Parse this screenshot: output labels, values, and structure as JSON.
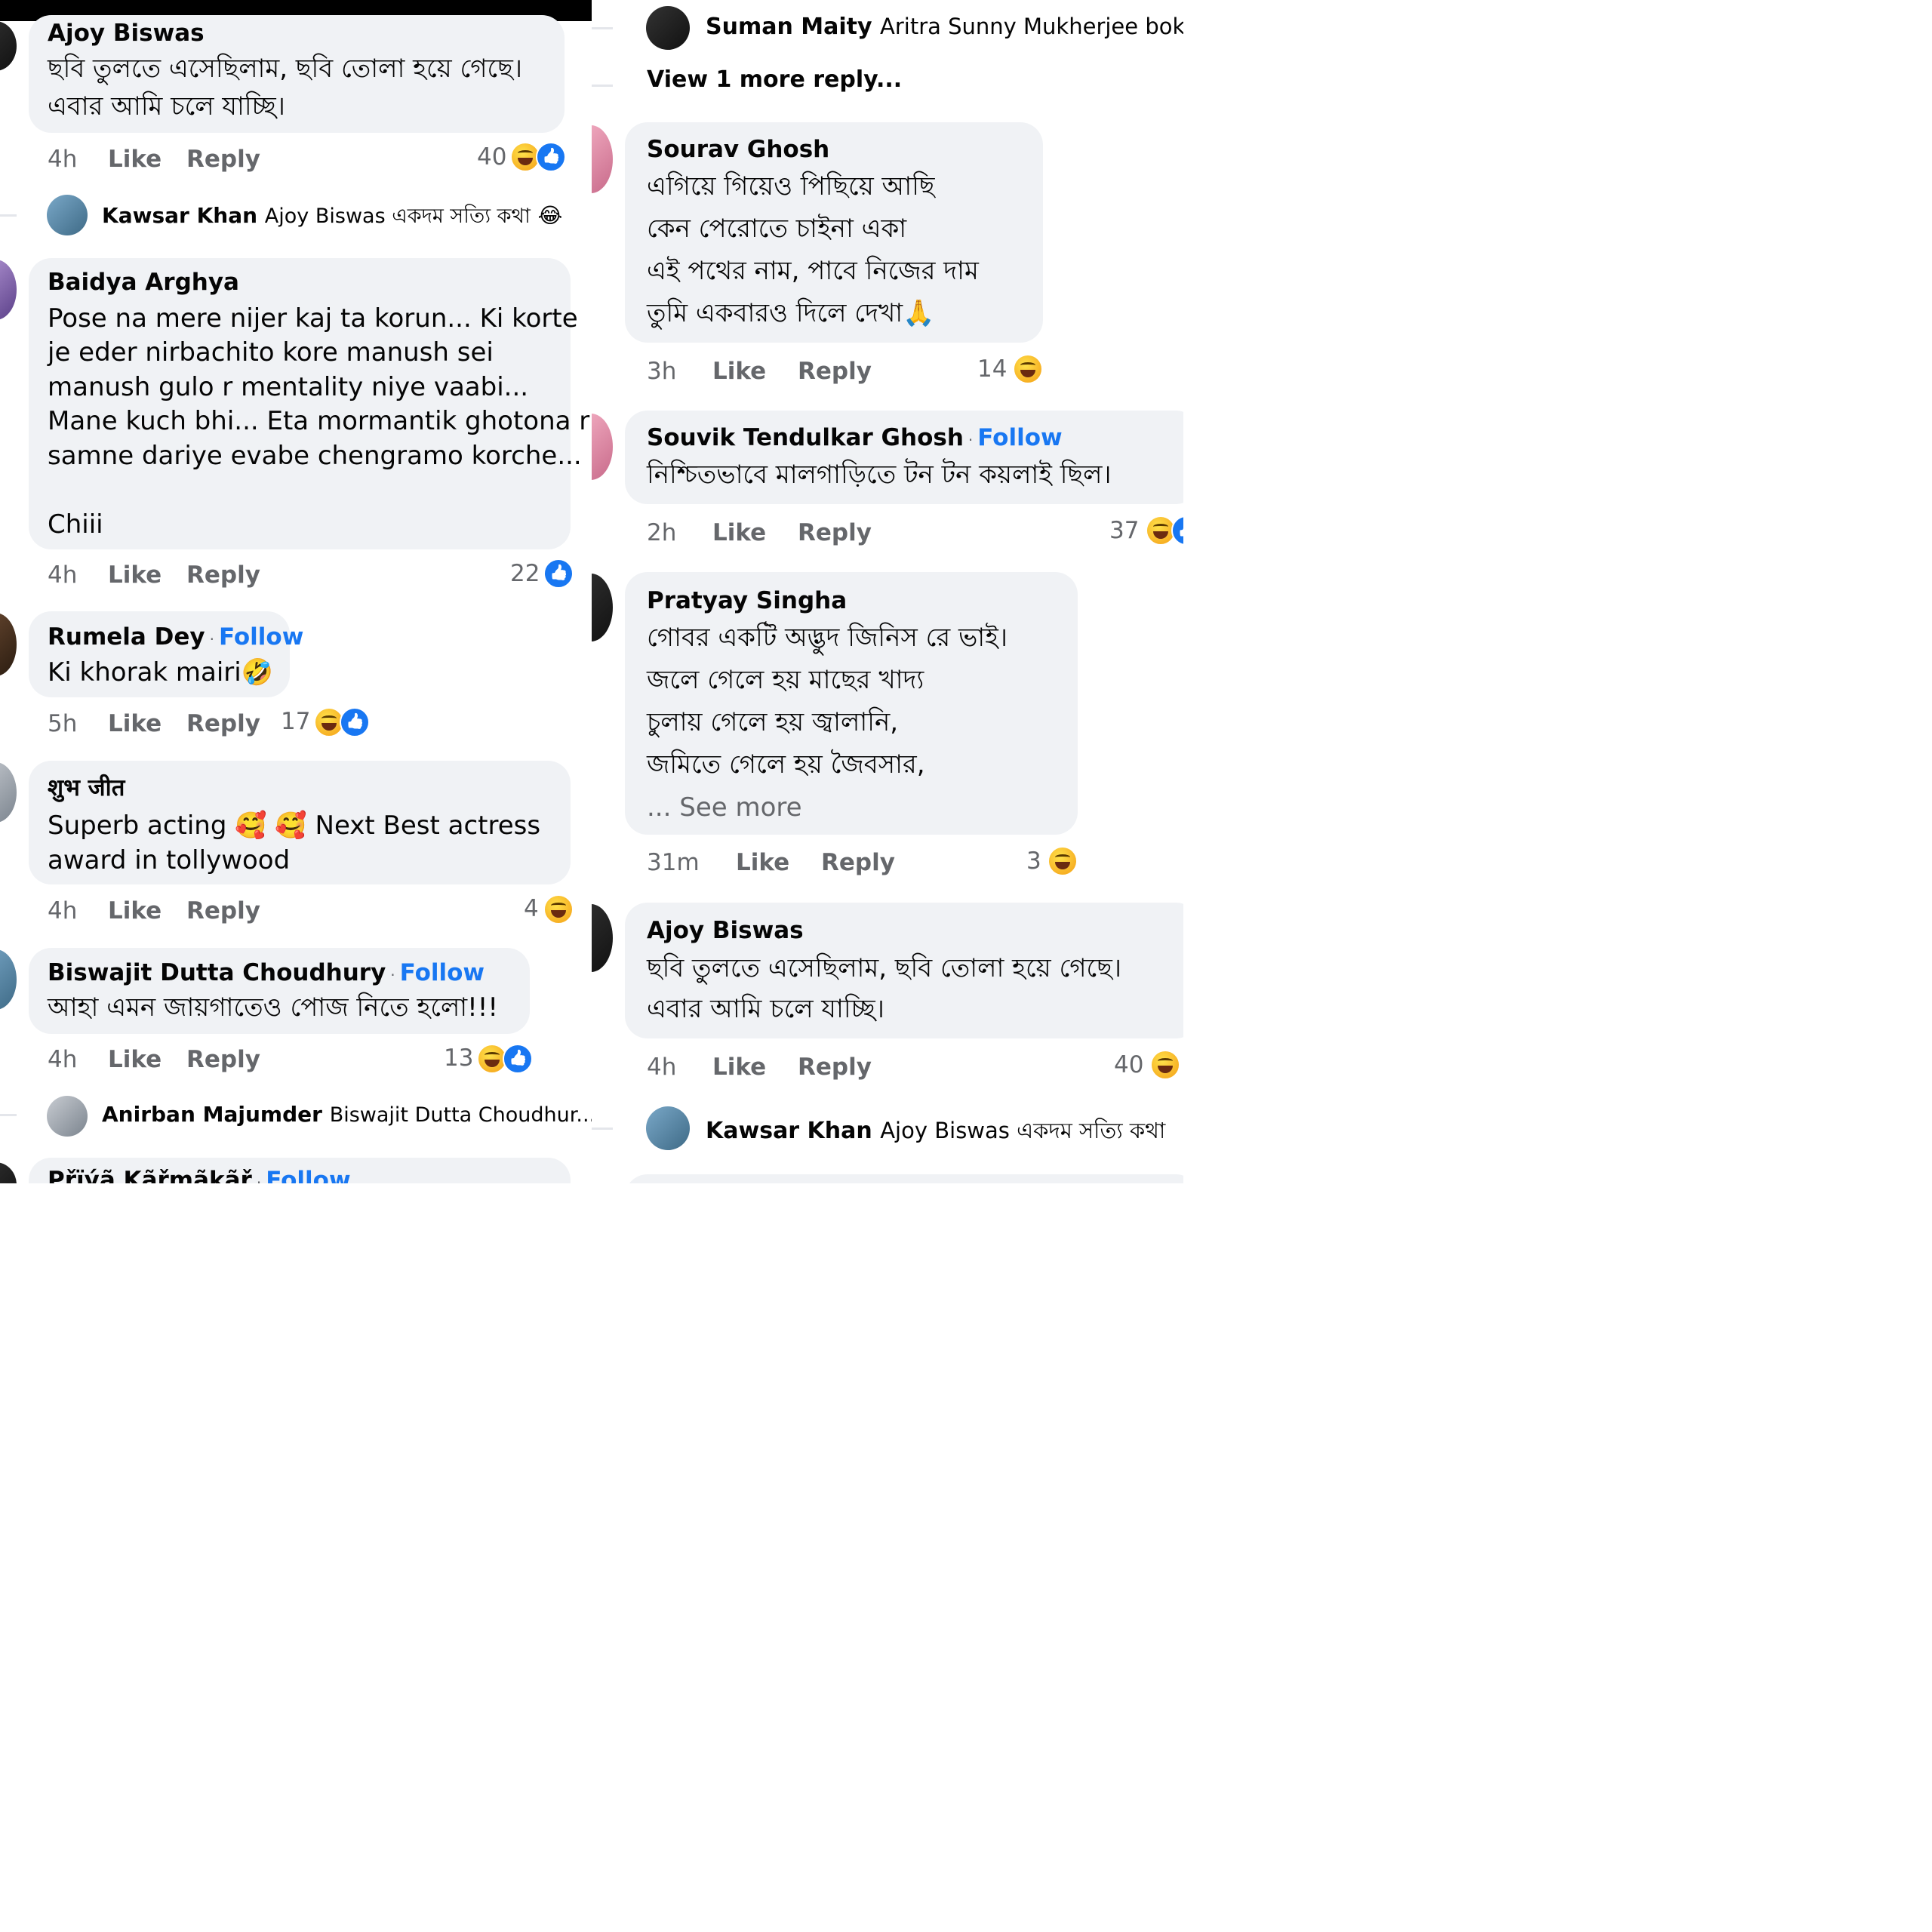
{
  "labels": {
    "like": "Like",
    "reply": "Reply",
    "follow": "Follow",
    "dot": "·"
  },
  "left": {
    "c1": {
      "name": "Ajoy Biswas",
      "lines": [
        "ছবি তুলতে এসেছিলাম,  ছবি তোলা হয়ে গেছে।",
        "এবার আমি চলে যাচ্ছি।"
      ],
      "time": "4h",
      "count": "40"
    },
    "r1": {
      "name": "Kawsar Khan",
      "text": "Ajoy Biswas একদম সত্যি কথা",
      "emoji": "😂"
    },
    "c2": {
      "name": "Baidya Arghya",
      "lines": [
        "Pose na mere nijer kaj ta korun... Ki korte",
        "je eder nirbachito kore manush sei",
        "manush gulo r mentality niye vaabi...",
        "Mane kuch bhi... Eta mormantik ghotona r",
        "samne dariye evabe chengramo korche..."
      ],
      "last": "Chiii",
      "time": "4h",
      "count": "22"
    },
    "c3": {
      "name": "Rumela Dey",
      "text": "Ki khorak mairi",
      "emoji": "🤣",
      "time": "5h",
      "count": "17"
    },
    "c4": {
      "name": "शुभ जीत",
      "line1a": "Superb acting",
      "line1emoji": "🥰 🥰",
      "line1b": "Next Best actress",
      "line2": "award in tollywood",
      "time": "4h",
      "count": "4"
    },
    "c5": {
      "name": "Biswajit Dutta Choudhury",
      "text": "আহা এমন জায়গাতেও পোজ নিতে হলো!!!",
      "time": "4h",
      "count": "13"
    },
    "r2": {
      "name": "Anirban Majumder",
      "text": "Biswajit Dutta Choudhur..."
    },
    "c6": {
      "name": "Přïýã Kãřmãkãř"
    }
  },
  "right": {
    "r0": {
      "name": "Suman Maity",
      "text": "Aritra Sunny Mukherjee bokac"
    },
    "more": "View 1 more reply...",
    "c1": {
      "name": "Sourav Ghosh",
      "lines": [
        "এগিয়ে গিয়েও পিছিয়ে আছি",
        "কেন পেরোতে চাইনা একা",
        "এই পথের নাম, পাবে নিজের দাম",
        "তুমি একবারও দিলে দেখা"
      ],
      "emoji": "🙏",
      "time": "3h",
      "count": "14"
    },
    "c2": {
      "name": "Souvik Tendulkar Ghosh",
      "text": "নিশ্চিতভাবে মালগাড়িতে টন টন কয়লাই ছিল।",
      "time": "2h",
      "count": "37"
    },
    "c3": {
      "name": "Pratyay Singha",
      "lines": [
        "গোবর একটি অদ্ভুদ জিনিস রে ভাই।",
        "জলে গেলে হয় মাছের খাদ্য",
        "চুলায় গেলে হয় জ্বালানি,",
        "জমিতে গেলে হয় জৈবসার,"
      ],
      "see_more": "... See more",
      "time": "31m",
      "count": "3"
    },
    "c4": {
      "name": "Ajoy Biswas",
      "lines": [
        "ছবি তুলতে এসেছিলাম,  ছবি তোলা হয়ে গেছে।",
        "এবার আমি চলে যাচ্ছি।"
      ],
      "time": "4h",
      "count": "40"
    },
    "r1": {
      "name": "Kawsar Khan",
      "text": "Ajoy Biswas একদম সত্যি কথা"
    }
  }
}
